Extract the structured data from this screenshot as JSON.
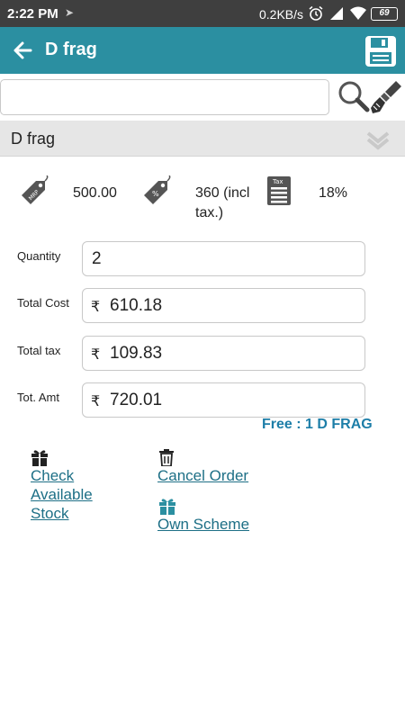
{
  "status_bar": {
    "time": "2:22 PM",
    "network_speed": "0.2KB/s",
    "battery": "69",
    "icons": [
      "navigation-arrow-icon",
      "alarm-icon",
      "signal-icon",
      "wifi-icon",
      "battery-icon"
    ]
  },
  "app_bar": {
    "title": "D frag",
    "back_icon": "back-arrow-icon",
    "save_icon": "save-floppy-icon",
    "color": "#2b8fa1"
  },
  "search": {
    "value": "",
    "placeholder": "",
    "search_icon": "search-icon",
    "clear_icon": "brush-icon"
  },
  "product": {
    "name": "D frag",
    "expand_icon": "chevron-down-icon"
  },
  "pricing": {
    "mrp": "500.00",
    "rate_line1": "360 (incl",
    "rate_line2": "tax.)",
    "tax_percent": "18%",
    "mrp_tag_label": "MRP",
    "rate_tag_label": "%",
    "tax_icon_label": "Tax"
  },
  "form": {
    "currency_symbol": "₹",
    "quantity": {
      "label": "Quantity",
      "value": "2"
    },
    "total_cost": {
      "label": "Total Cost",
      "value": "610.18"
    },
    "total_tax": {
      "label": "Total tax",
      "value": "109.83"
    },
    "total_amount": {
      "label": "Tot. Amt",
      "value": "720.01"
    }
  },
  "free_text": "Free : 1 D FRAG",
  "actions": {
    "check_stock_line1": "Check",
    "check_stock_line2": "Available",
    "check_stock_line3": "Stock",
    "cancel_order": "Cancel Order",
    "own_scheme": "Own Scheme"
  },
  "colors": {
    "accent": "#2b8fa1",
    "link": "#1d6f86",
    "free_text": "#1d7ea8",
    "header_gray": "#e6e6e6"
  }
}
